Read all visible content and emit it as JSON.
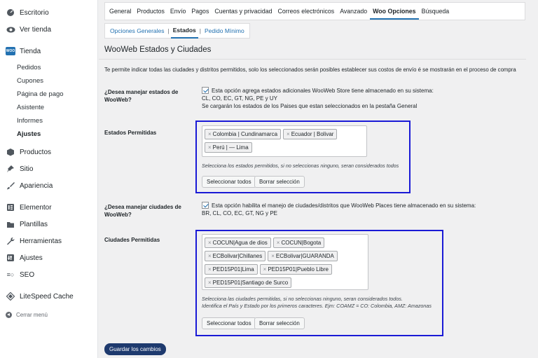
{
  "sidebar": {
    "items": [
      {
        "name": "escritorio",
        "label": "Escritorio",
        "icon": "dashboard-icon"
      },
      {
        "name": "ver-tienda",
        "label": "Ver tienda",
        "icon": "eye-icon"
      },
      {
        "name": "tienda",
        "label": "Tienda",
        "icon": "woo-icon",
        "badge": "WOO"
      },
      {
        "name": "productos",
        "label": "Productos",
        "icon": "box-icon"
      },
      {
        "name": "sitio",
        "label": "Sitio",
        "icon": "pin-icon"
      },
      {
        "name": "apariencia",
        "label": "Apariencia",
        "icon": "brush-icon"
      },
      {
        "name": "elementor",
        "label": "Elementor",
        "icon": "elementor-icon"
      },
      {
        "name": "plantillas",
        "label": "Plantillas",
        "icon": "folder-icon"
      },
      {
        "name": "herramientas",
        "label": "Herramientas",
        "icon": "wrench-icon"
      },
      {
        "name": "ajustes",
        "label": "Ajustes",
        "icon": "settings-icon"
      },
      {
        "name": "seo",
        "label": "SEO",
        "icon": "seo-icon"
      },
      {
        "name": "litespeed",
        "label": "LiteSpeed Cache",
        "icon": "diamond-icon"
      }
    ],
    "tienda_submenu": [
      "Pedidos",
      "Cupones",
      "Página de pago",
      "Asistente",
      "Informes",
      "Ajustes"
    ],
    "collapse_label": "Cerrar menú"
  },
  "tabs": [
    "General",
    "Productos",
    "Envío",
    "Pagos",
    "Cuentas y privacidad",
    "Correos electrónicos",
    "Avanzado",
    "Woo Opciones",
    "Búsqueda"
  ],
  "active_tab": "Woo Opciones",
  "subtabs": [
    "Opciones Generales",
    "Estados",
    "Pedido Mínimo"
  ],
  "active_subtab": "Estados",
  "page_title": "WooWeb Estados y Ciudades",
  "description": "Te permite indicar todas las ciudades y distritos permitidos, solo los seleccionados serán posibles establecer sus costos de envío é se mostrarán en el proceso de compra",
  "estados_toggle": {
    "label_line1": "¿Desea manejar estados de",
    "label_line2": "WooWeb?",
    "text_line1": "Esta opción agrega estados adicionales WooWeb Store tiene almacenado en su sistema:",
    "text_line2": "CL, CO, EC, GT, NG, PE y UY",
    "text_line3": "Se cargarán los estados de los Paises que estan seleccionados en la pestaña General"
  },
  "estados_permitidos": {
    "label": "Estados Permitidas",
    "chips": [
      "Colombia | Cundinamarca",
      "Ecuador | Bolivar",
      "Perú | — Lima"
    ],
    "hint": "Selecciona los estados permitidos, si no seleccionas ninguno, seran considerados todos",
    "select_all": "Seleccionar todos",
    "clear": "Borrar selección"
  },
  "ciudades_toggle": {
    "label_line1": "¿Desea manejar ciudades de",
    "label_line2": "WooWeb?",
    "text_line1": "Esta opción habilita el manejo de ciudades/distritos que WooWeb Places tiene almacenado en su sistema:",
    "text_line2": "BR, CL, CO, EC, GT, NG y PE"
  },
  "ciudades_permitidas": {
    "label": "Ciudades Permitidas",
    "chips": [
      "COCUN|Agua de dios",
      "COCUN|Bogota",
      "ECBolivar|Chillanes",
      "ECBolivar|GUARANDA",
      "PED15P01|Lima",
      "PED15P01|Pueblo Libre",
      "PED15P01|Santiago de Surco"
    ],
    "hint_line1": "Selecciona las ciudades permitidas, si no seleccionas ninguno, seran considerados todos.",
    "hint_line2": "Identifica el País y Estado por los primeros caracteres. Ejm: COAMZ = CO: Colombia, AMZ: Amazonas",
    "select_all": "Seleccionar todos",
    "clear": "Borrar selección"
  },
  "save_button": "Guardar los cambios",
  "colors": {
    "accent": "#2271b1",
    "highlight_box": "#1a1ad6",
    "primary_button": "#1e3a6e"
  }
}
